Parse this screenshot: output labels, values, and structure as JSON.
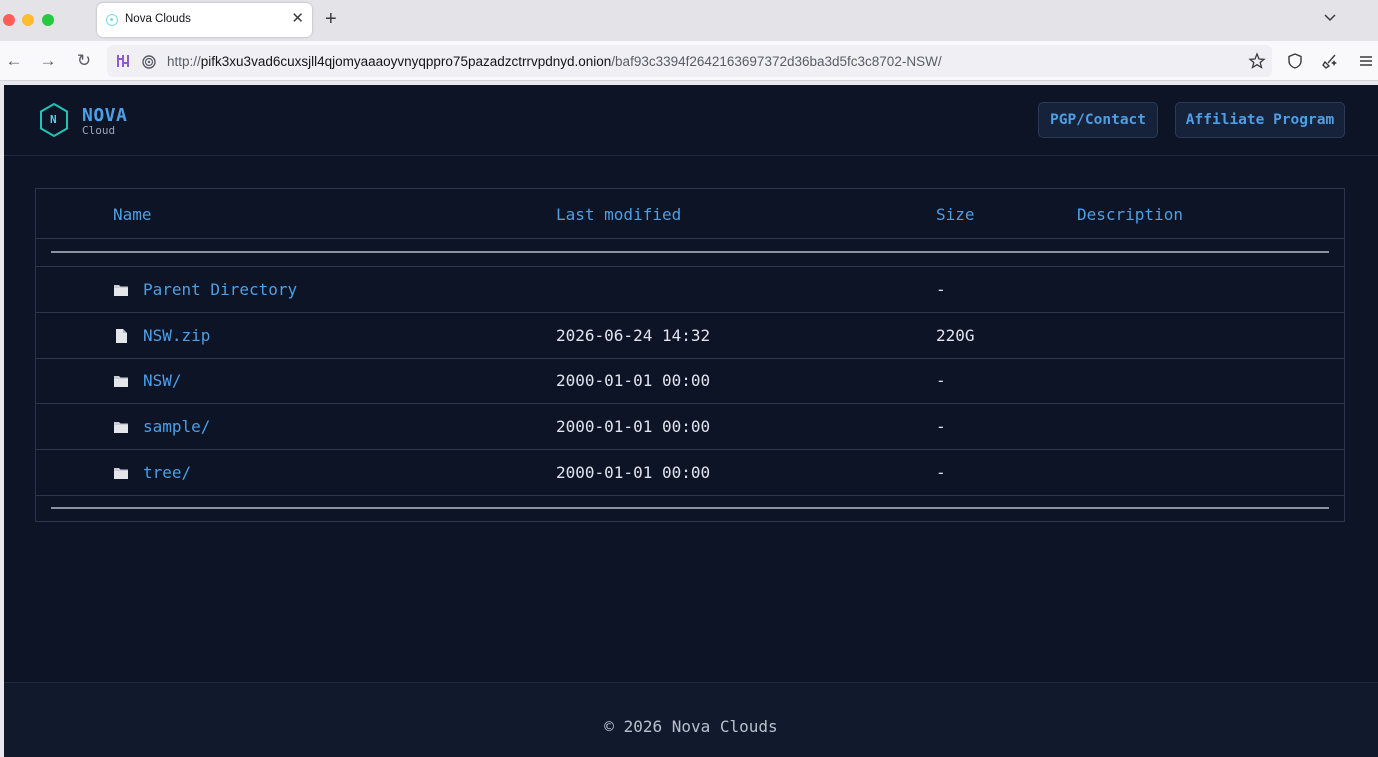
{
  "browser": {
    "tab_title": "Nova Clouds",
    "url_prefix": "http://",
    "url_host": "pifk3xu3vad6cuxsjll4qjomyaaaoyvnyqppro75pazadzctrrvpdnyd.onion",
    "url_path": "/baf93c3394f2642163697372d36ba3d5fc3c8702-NSW/"
  },
  "header": {
    "logo_letter": "N",
    "logo_name": "NOVA",
    "logo_sub": "Cloud",
    "pgp_button": "PGP/Contact",
    "affiliate_button": "Affiliate Program"
  },
  "listing": {
    "columns": {
      "name": "Name",
      "last_modified": "Last modified",
      "size": "Size",
      "description": "Description"
    },
    "rows": [
      {
        "icon": "folder-icon",
        "name": "Parent Directory",
        "modified": "",
        "size": "-",
        "description": ""
      },
      {
        "icon": "file-icon",
        "name": "NSW.zip",
        "modified": "2026-06-24 14:32",
        "size": "220G",
        "description": ""
      },
      {
        "icon": "folder-icon",
        "name": "NSW/",
        "modified": "2000-01-01 00:00",
        "size": "-",
        "description": ""
      },
      {
        "icon": "folder-icon",
        "name": "sample/",
        "modified": "2000-01-01 00:00",
        "size": "-",
        "description": ""
      },
      {
        "icon": "folder-icon",
        "name": "tree/",
        "modified": "2000-01-01 00:00",
        "size": "-",
        "description": ""
      }
    ]
  },
  "footer": {
    "copyright": "© 2026 Nova Clouds"
  },
  "colors": {
    "page_bg": "#0c1425",
    "accent": "#4d9fe6",
    "text": "#dfe5ee"
  }
}
